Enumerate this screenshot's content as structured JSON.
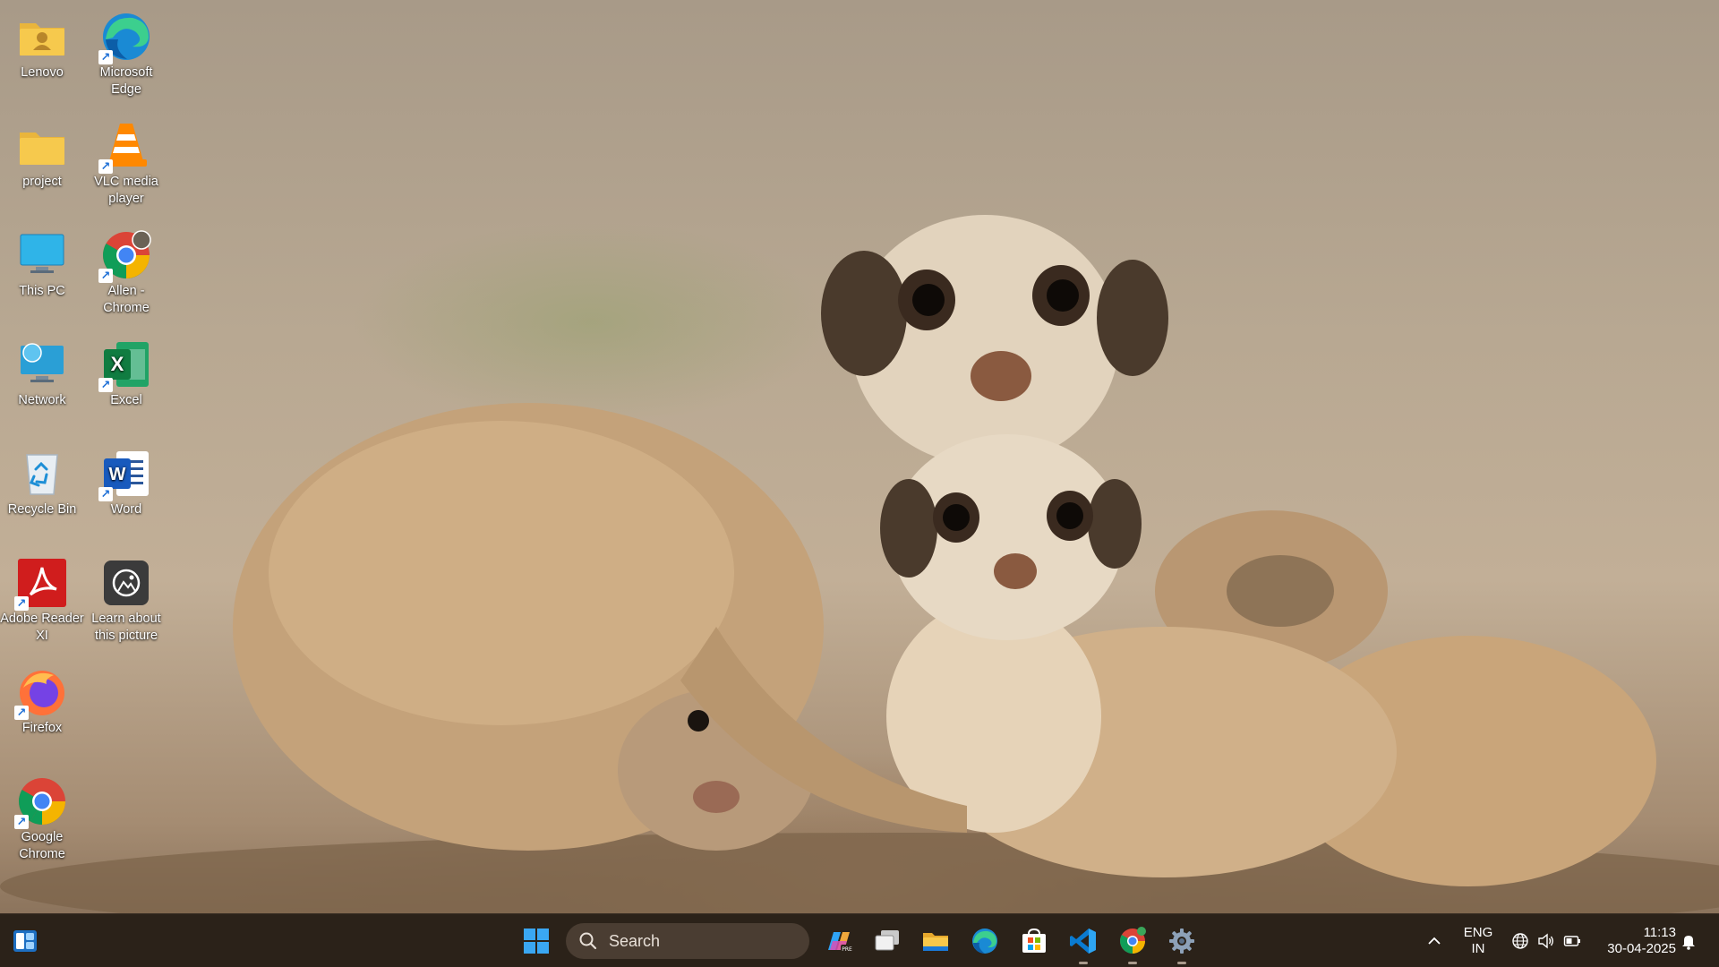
{
  "desktop": {
    "icons": [
      {
        "label": "Lenovo"
      },
      {
        "label": "Microsoft Edge"
      },
      {
        "label": "project"
      },
      {
        "label": "VLC media player"
      },
      {
        "label": "This PC"
      },
      {
        "label": "Allen - Chrome"
      },
      {
        "label": "Network"
      },
      {
        "label": "Excel"
      },
      {
        "label": "Recycle Bin"
      },
      {
        "label": "Word"
      },
      {
        "label": "Adobe Reader XI"
      },
      {
        "label": "Learn about this picture"
      },
      {
        "label": "Firefox"
      },
      {
        "label": "Google Chrome"
      }
    ]
  },
  "taskbar": {
    "search_placeholder": "Search",
    "pinned": [
      {
        "icon": "copilot-icon"
      },
      {
        "icon": "task-view-icon"
      },
      {
        "icon": "file-explorer-icon"
      },
      {
        "icon": "edge-icon"
      },
      {
        "icon": "microsoft-store-icon"
      },
      {
        "icon": "vscode-icon"
      },
      {
        "icon": "chrome-icon"
      },
      {
        "icon": "settings-icon"
      }
    ],
    "tray": {
      "language": "ENG",
      "region": "IN",
      "time": "11:13",
      "date": "30-04-2025"
    }
  },
  "colors": {
    "taskbar_bg": "#2b2219",
    "search_bg": "#4a3d32",
    "accent_blue": "#0078d4"
  }
}
